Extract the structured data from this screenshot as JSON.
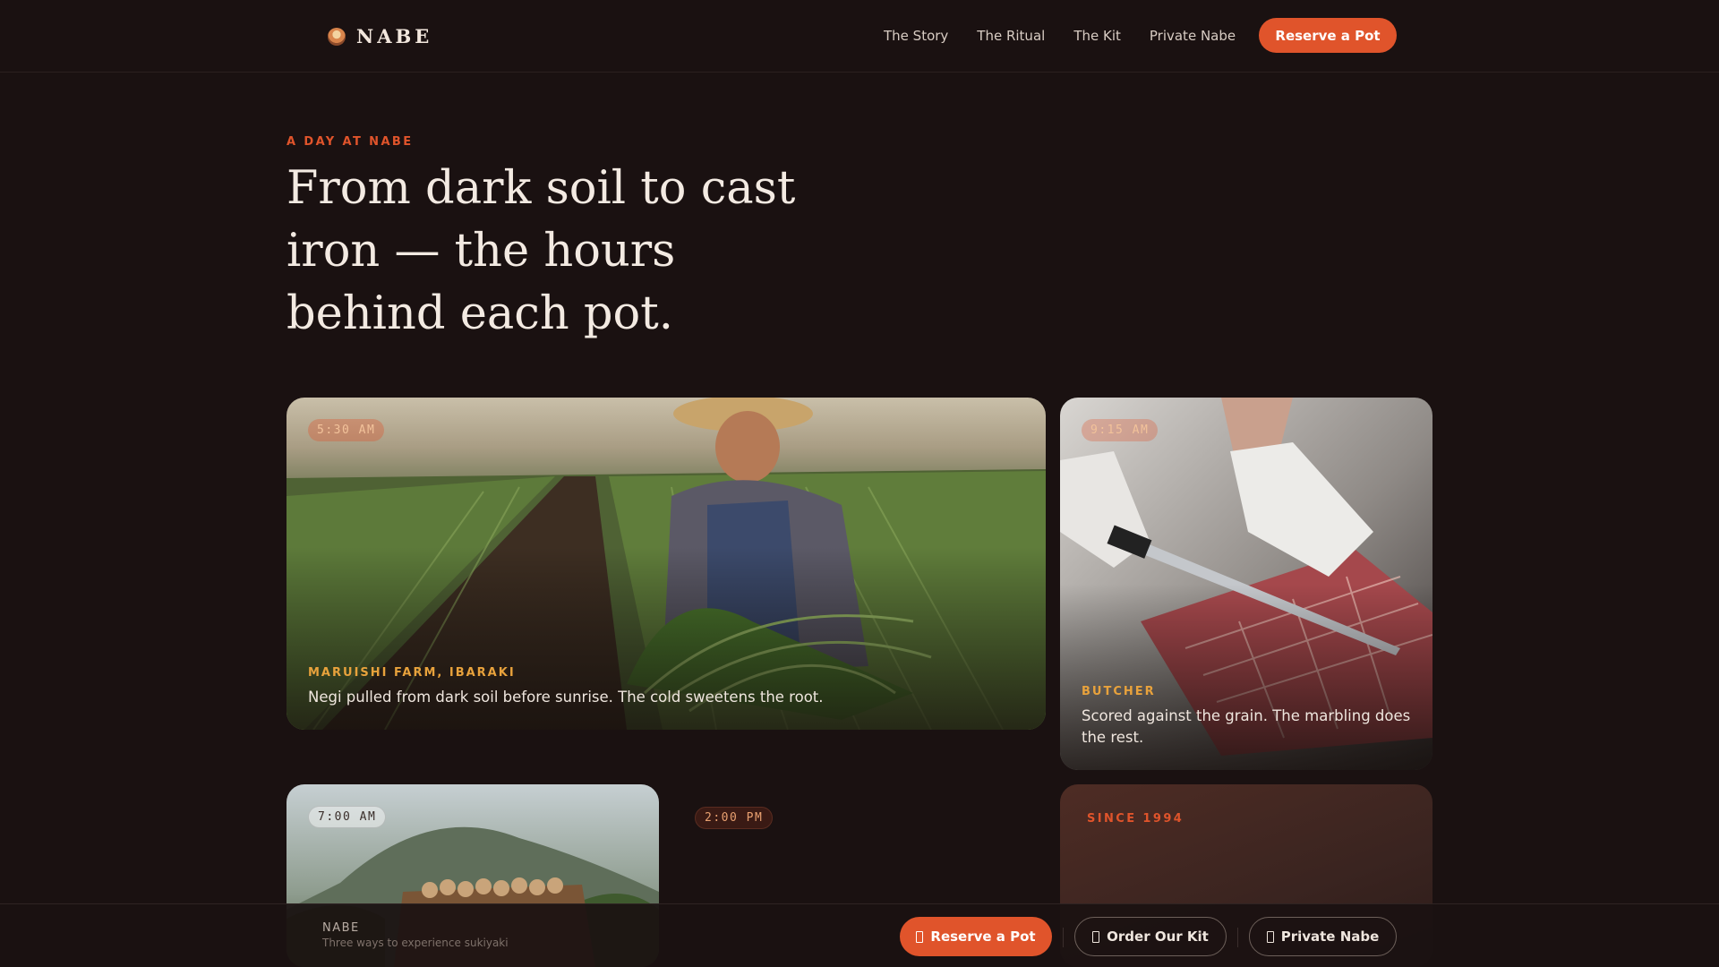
{
  "header": {
    "brand": "NABE",
    "nav": [
      "The Story",
      "The Ritual",
      "The Kit",
      "Private Nabe"
    ],
    "cta": "Reserve a Pot"
  },
  "hero": {
    "eyebrow": "A DAY AT NABE",
    "title": "From dark soil to cast iron — the hours behind each pot."
  },
  "cards": {
    "farm": {
      "time": "5:30 AM",
      "label": "MARUISHI FARM, IBARAKI",
      "text": "Negi pulled from dark soil before sunrise. The cold sweetens the root."
    },
    "butcher": {
      "time": "9:15 AM",
      "label": "BUTCHER",
      "text": "Scored against the grain. The marbling does the rest."
    },
    "market": {
      "time": "7:00 AM"
    },
    "afternoon": {
      "time": "2:00 PM"
    },
    "since": {
      "label": "SINCE 1994"
    }
  },
  "bottom_bar": {
    "name": "NABE",
    "subtitle": "Three ways to experience sukiyaki",
    "buttons": [
      "Reserve a Pot",
      "Order Our Kit",
      "Private Nabe"
    ]
  },
  "colors": {
    "background": "#1a1111",
    "accent": "#e0542b",
    "label_gold": "#e8a23c"
  }
}
